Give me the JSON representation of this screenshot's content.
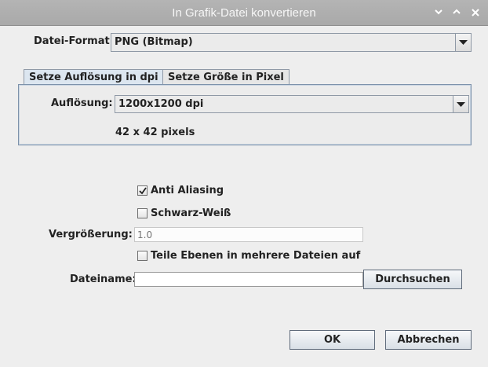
{
  "window": {
    "title": "In Grafik-Datei konvertieren",
    "controls": [
      "minimize-icon",
      "maximize-icon",
      "close-icon"
    ]
  },
  "format": {
    "label": "Datei-Format:",
    "value": "PNG (Bitmap)"
  },
  "tabs": [
    {
      "label": "Setze Auflösung in dpi",
      "selected": true
    },
    {
      "label": "Setze Größe in Pixel",
      "selected": false
    }
  ],
  "resolution": {
    "label": "Auflösung:",
    "value": "1200x1200 dpi",
    "pixels_text": "42 x 42 pixels"
  },
  "options": {
    "anti_aliasing": {
      "label": "Anti Aliasing",
      "checked": true
    },
    "black_white": {
      "label": "Schwarz-Weiß",
      "checked": false
    },
    "magnification": {
      "label": "Vergrößerung:",
      "placeholder": "1.0",
      "enabled": false
    },
    "split_layers": {
      "label": "Teile Ebenen in mehrere Dateien auf",
      "checked": false
    }
  },
  "filename": {
    "label": "Dateiname:",
    "value": "",
    "browse_label": "Durchsuchen"
  },
  "footer": {
    "ok_label": "OK",
    "cancel_label": "Abbrechen"
  }
}
